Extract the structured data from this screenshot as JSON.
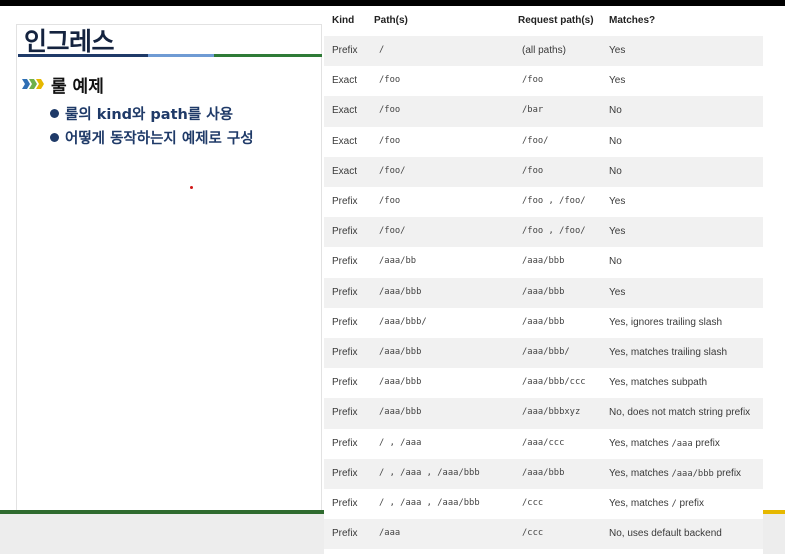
{
  "slide": {
    "title": "인그레스",
    "section_heading": "룰 예제",
    "bullets": [
      "룰의 kind와 path를 사용",
      "어떻게 동작하는지 예제로 구성"
    ]
  },
  "table": {
    "headers": {
      "kind": "Kind",
      "path": "Path(s)",
      "request": "Request path(s)",
      "matches": "Matches?"
    },
    "rows": [
      {
        "kind": "Prefix",
        "path": "/",
        "request": "(all paths)",
        "matches": "Yes"
      },
      {
        "kind": "Exact",
        "path": "/foo",
        "request": "/foo",
        "matches": "Yes"
      },
      {
        "kind": "Exact",
        "path": "/foo",
        "request": "/bar",
        "matches": "No"
      },
      {
        "kind": "Exact",
        "path": "/foo",
        "request": "/foo/",
        "matches": "No"
      },
      {
        "kind": "Exact",
        "path": "/foo/",
        "request": "/foo",
        "matches": "No"
      },
      {
        "kind": "Prefix",
        "path": "/foo",
        "request": "/foo , /foo/",
        "matches": "Yes"
      },
      {
        "kind": "Prefix",
        "path": "/foo/",
        "request": "/foo , /foo/",
        "matches": "Yes"
      },
      {
        "kind": "Prefix",
        "path": "/aaa/bb",
        "request": "/aaa/bbb",
        "matches": "No"
      },
      {
        "kind": "Prefix",
        "path": "/aaa/bbb",
        "request": "/aaa/bbb",
        "matches": "Yes"
      },
      {
        "kind": "Prefix",
        "path": "/aaa/bbb/",
        "request": "/aaa/bbb",
        "matches": "Yes, ignores trailing slash"
      },
      {
        "kind": "Prefix",
        "path": "/aaa/bbb",
        "request": "/aaa/bbb/",
        "matches": "Yes, matches trailing slash"
      },
      {
        "kind": "Prefix",
        "path": "/aaa/bbb",
        "request": "/aaa/bbb/ccc",
        "matches": "Yes, matches subpath"
      },
      {
        "kind": "Prefix",
        "path": "/aaa/bbb",
        "request": "/aaa/bbbxyz",
        "matches": "No, does not match string prefix"
      },
      {
        "kind": "Prefix",
        "path": "/ , /aaa",
        "request": "/aaa/ccc",
        "matches_prefix": "Yes, matches ",
        "matches_code": "/aaa",
        "matches_suffix": " prefix"
      },
      {
        "kind": "Prefix",
        "path": "/ , /aaa , /aaa/bbb",
        "request": "/aaa/bbb",
        "matches_prefix": "Yes, matches ",
        "matches_code": "/aaa/bbb",
        "matches_suffix": " prefix"
      },
      {
        "kind": "Prefix",
        "path": "/ , /aaa , /aaa/bbb",
        "request": "/ccc",
        "matches_prefix": "Yes, matches ",
        "matches_code": "/",
        "matches_suffix": " prefix"
      },
      {
        "kind": "Prefix",
        "path": "/aaa",
        "request": "/ccc",
        "matches": "No, uses default backend"
      }
    ]
  },
  "colors": {
    "title": "#14233f",
    "bullet": "#1f3a68",
    "row_shade": "#f1f1f1",
    "bottom_rule_left": "#2f6b2f",
    "bottom_rule_right": "#e6b800"
  }
}
